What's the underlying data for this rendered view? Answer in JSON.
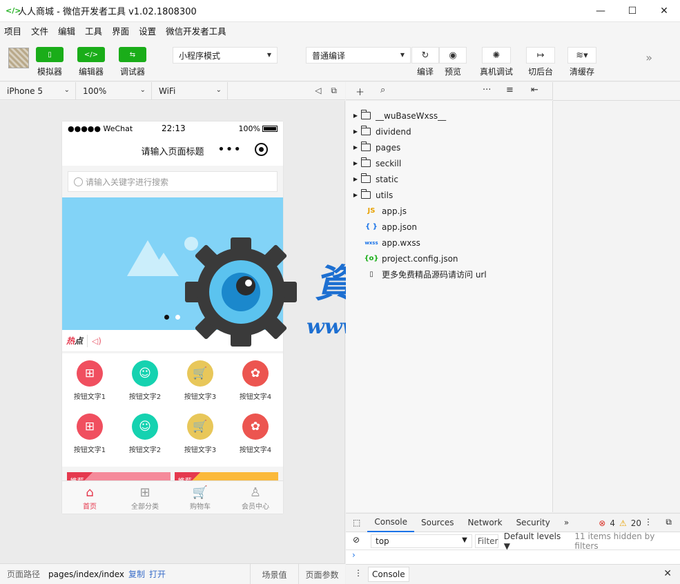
{
  "window": {
    "title": "人人商城 - 微信开发者工具 v1.02.1808300",
    "min": "—",
    "max": "☐",
    "close": "✕"
  },
  "menu": [
    "项目",
    "文件",
    "编辑",
    "工具",
    "界面",
    "设置",
    "微信开发者工具"
  ],
  "toolbar": {
    "simulator_label": "模拟器",
    "editor_label": "编辑器",
    "debugger_label": "调试器",
    "mode_select": "小程序模式",
    "compile_select": "普通编译",
    "compile_label": "编译",
    "preview_label": "预览",
    "remote_debug_label": "真机调试",
    "background_label": "切后台",
    "clear_cache_label": "清缓存",
    "more": "»"
  },
  "simbar": {
    "device": "iPhone 5",
    "zoom": "100%",
    "network": "WiFi"
  },
  "phone": {
    "status_left": "●●●●● WeChat",
    "time": "22:13",
    "battery": "100%",
    "nav_title": "请输入页面标题",
    "nav_dots": "•••",
    "search_placeholder": "请输入关键字进行搜索",
    "hot_label_1": "热",
    "hot_label_2": "点",
    "grid": [
      {
        "label": "按钮文字1",
        "icon": "grid-apps-icon",
        "color": "#f04f5f",
        "glyph": "⊞"
      },
      {
        "label": "按钮文字2",
        "icon": "user-icon",
        "color": "#15d2b0",
        "glyph": "☺"
      },
      {
        "label": "按钮文字3",
        "icon": "cart-icon",
        "color": "#e8c75a",
        "glyph": "🛒"
      },
      {
        "label": "按钮文字4",
        "icon": "award-icon",
        "color": "#ec5550",
        "glyph": "✿"
      },
      {
        "label": "按钮文字1",
        "icon": "grid-apps-icon",
        "color": "#f04f5f",
        "glyph": "⊞"
      },
      {
        "label": "按钮文字2",
        "icon": "user-icon",
        "color": "#15d2b0",
        "glyph": "☺"
      },
      {
        "label": "按钮文字3",
        "icon": "cart-icon",
        "color": "#e8c75a",
        "glyph": "🛒"
      },
      {
        "label": "按钮文字4",
        "icon": "award-icon",
        "color": "#ec5550",
        "glyph": "✿"
      }
    ],
    "card_tag": "推荐",
    "tabs": [
      {
        "label": "首页",
        "icon": "home-icon",
        "glyph": "⌂"
      },
      {
        "label": "全部分类",
        "icon": "category-icon",
        "glyph": "⊞"
      },
      {
        "label": "购物车",
        "icon": "cart-icon",
        "glyph": "🛒"
      },
      {
        "label": "会员中心",
        "icon": "member-icon",
        "glyph": "♙"
      }
    ]
  },
  "bottombar": {
    "path_key": "页面路径",
    "path": "pages/index/index",
    "copy": "复制",
    "open": "打开",
    "scene": "场景值",
    "params": "页面参数"
  },
  "files": {
    "folders": [
      "__wuBaseWxss__",
      "dividend",
      "pages",
      "seckill",
      "static",
      "utils"
    ],
    "items": [
      {
        "name": "app.js",
        "badge": "JS",
        "color": "#e8a100"
      },
      {
        "name": "app.json",
        "badge": "{ }",
        "color": "#1a73e8"
      },
      {
        "name": "app.wxss",
        "badge": "wxss",
        "color": "#1a73e8"
      },
      {
        "name": "project.config.json",
        "badge": "{o}",
        "color": "#1aad19"
      },
      {
        "name": "更多免费精品源码请访问 url",
        "badge": "▯",
        "color": "#333"
      }
    ]
  },
  "devtools": {
    "tabs": [
      "Console",
      "Sources",
      "Network",
      "Security"
    ],
    "more": "»",
    "errors": "4",
    "warnings": "20",
    "context": "top",
    "filter": "Filter",
    "levels": "Default levels ▼",
    "hidden": "11 items hidden by filters",
    "prompt": "›",
    "drawer_tab": "Console"
  },
  "watermark": {
    "cn": "資源邦",
    "url": "www.wazyb.com"
  }
}
